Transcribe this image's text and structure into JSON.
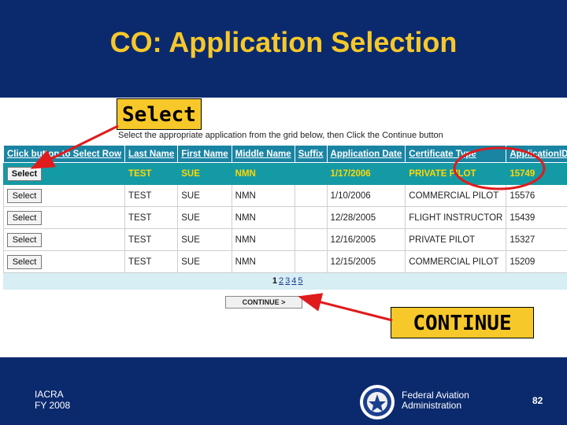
{
  "slide": {
    "title": "CO: Application Selection",
    "footer_line1": "IACRA",
    "footer_line2": "FY 2008",
    "agency_line1": "Federal Aviation",
    "agency_line2": "Administration",
    "page_number": "82"
  },
  "callouts": {
    "select": "Select",
    "continue": "CONTINUE"
  },
  "app": {
    "instruction": "Select the appropriate application from the grid below, then Click the Continue button",
    "columns": [
      "Click button to Select Row",
      "Last Name",
      "First Name",
      "Middle Name",
      "Suffix",
      "Application Date",
      "Certificate Type",
      "ApplicationID"
    ],
    "select_label": "Select",
    "rows": [
      [
        "TEST",
        "SUE",
        "NMN",
        "",
        "1/17/2006",
        "PRIVATE PILOT",
        "15749"
      ],
      [
        "TEST",
        "SUE",
        "NMN",
        "",
        "1/10/2006",
        "COMMERCIAL PILOT",
        "15576"
      ],
      [
        "TEST",
        "SUE",
        "NMN",
        "",
        "12/28/2005",
        "FLIGHT INSTRUCTOR",
        "15439"
      ],
      [
        "TEST",
        "SUE",
        "NMN",
        "",
        "12/16/2005",
        "PRIVATE PILOT",
        "15327"
      ],
      [
        "TEST",
        "SUE",
        "NMN",
        "",
        "12/15/2005",
        "COMMERCIAL PILOT",
        "15209"
      ]
    ],
    "pager": [
      "1",
      "2",
      "3",
      "4",
      "5"
    ],
    "continue_label": "CONTINUE >"
  },
  "colors": {
    "slide_bg": "#0b2a6e",
    "title": "#f7c829",
    "grid_header": "#1a84a3",
    "selected_row": "#149aa5",
    "highlight_red": "#e01b1b"
  },
  "icons": [
    "faa-seal-icon",
    "arrow-icon",
    "highlight-ellipse"
  ]
}
